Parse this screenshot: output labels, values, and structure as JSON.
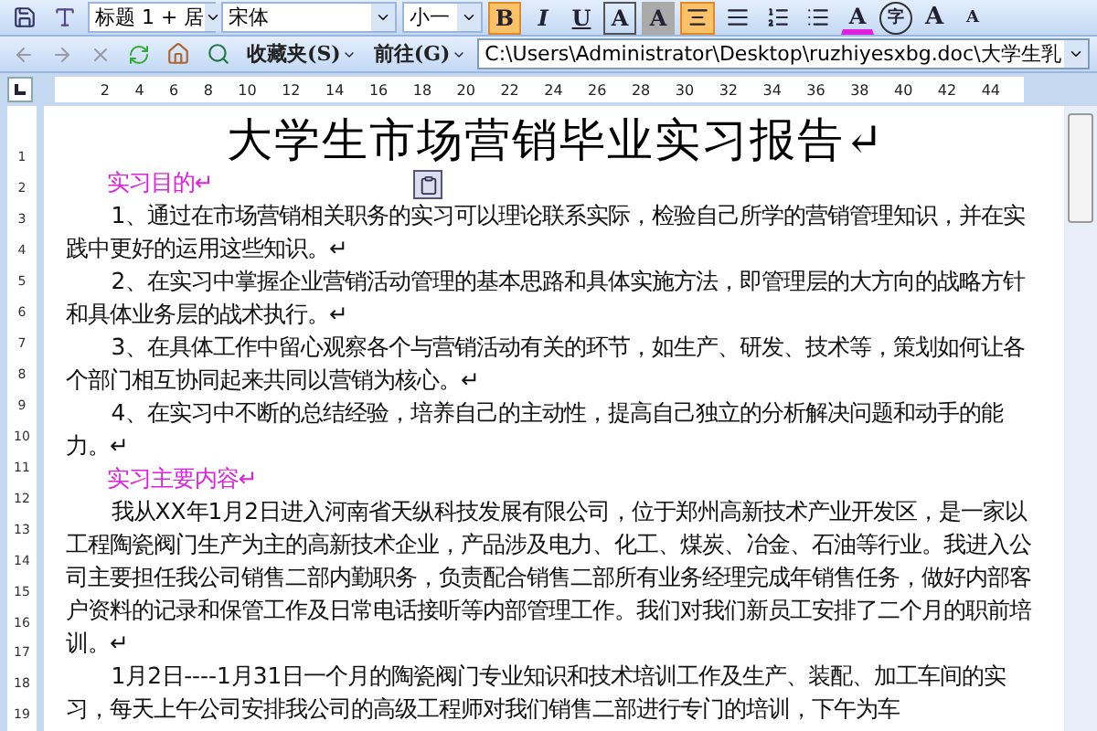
{
  "format_toolbar": {
    "style": "标题 1 + 居",
    "font": "宋体",
    "size": "小一",
    "buttons": [
      {
        "label": "B",
        "kind": "bold",
        "selected": true
      },
      {
        "label": "I",
        "kind": "italic",
        "selected": false
      },
      {
        "label": "U",
        "kind": "underline",
        "selected": false
      },
      {
        "label": "A",
        "kind": "boxed",
        "selected": false
      },
      {
        "label": "A",
        "kind": "shaded",
        "selected": false
      },
      {
        "kind": "align-center",
        "selected": true
      },
      {
        "kind": "align-justify",
        "selected": false
      },
      {
        "kind": "numbered-list",
        "selected": false
      },
      {
        "kind": "bullet-list",
        "selected": false
      },
      {
        "label": "A",
        "kind": "font-color",
        "selected": false
      },
      {
        "label": "字",
        "kind": "enclose",
        "selected": false
      },
      {
        "label": "A",
        "kind": "grow",
        "selected": false
      },
      {
        "label": "A",
        "kind": "shrink",
        "selected": false
      }
    ]
  },
  "web_toolbar": {
    "favorites": "收藏夹(S)",
    "go": "前往(G)",
    "address": "C:\\Users\\Administrator\\Desktop\\ruzhiyesxbg.doc\\大学生乳"
  },
  "ruler": [
    "2",
    "4",
    "6",
    "8",
    "10",
    "12",
    "14",
    "16",
    "18",
    "20",
    "22",
    "24",
    "26",
    "28",
    "30",
    "32",
    "34",
    "36",
    "38",
    "40",
    "42",
    "44"
  ],
  "vertical_ruler": [
    "1",
    "2",
    "3",
    "4",
    "5",
    "6",
    "7",
    "8",
    "9",
    "10",
    "11",
    "12",
    "13",
    "14",
    "15",
    "16",
    "17",
    "18",
    "19"
  ],
  "document": {
    "title": "大学生市场营销毕业实习报告↵",
    "paragraphs": [
      {
        "kind": "heading",
        "text": "实习目的↵"
      },
      {
        "kind": "body",
        "text": "1、通过在市场营销相关职务的实习可以理论联系实际，检验自己所学的营销管理知识，并在实践中更好的运用这些知识。↵"
      },
      {
        "kind": "body",
        "text": "2、在实习中掌握企业营销活动管理的基本思路和具体实施方法，即管理层的大方向的战略方针和具体业务层的战术执行。↵"
      },
      {
        "kind": "body",
        "text": "3、在具体工作中留心观察各个与营销活动有关的环节，如生产、研发、技术等，策划如何让各个部门相互协同起来共同以营销为核心。↵"
      },
      {
        "kind": "body",
        "text": "4、在实习中不断的总结经验，培养自己的主动性，提高自己独立的分析解决问题和动手的能力。↵"
      },
      {
        "kind": "heading",
        "text": "实习主要内容↵"
      },
      {
        "kind": "body",
        "text": "我从XX年1月2日进入河南省天纵科技发展有限公司，位于郑州高新技术产业开发区，是一家以工程陶瓷阀门生产为主的高新技术企业，产品涉及电力、化工、煤炭、冶金、石油等行业。我进入公司主要担任我公司销售二部内勤职务，负责配合销售二部所有业务经理完成年销售任务，做好内部客户资料的记录和保管工作及日常电话接听等内部管理工作。我们对我们新员工安排了二个月的职前培训。↵"
      },
      {
        "kind": "body",
        "text": "1月2日----1月31日一个月的陶瓷阀门专业知识和技术培训工作及生产、装配、加工车间的实习，每天上午公司安排我公司的高级工程师对我们销售二部进行专门的培训，下午为车"
      }
    ]
  }
}
